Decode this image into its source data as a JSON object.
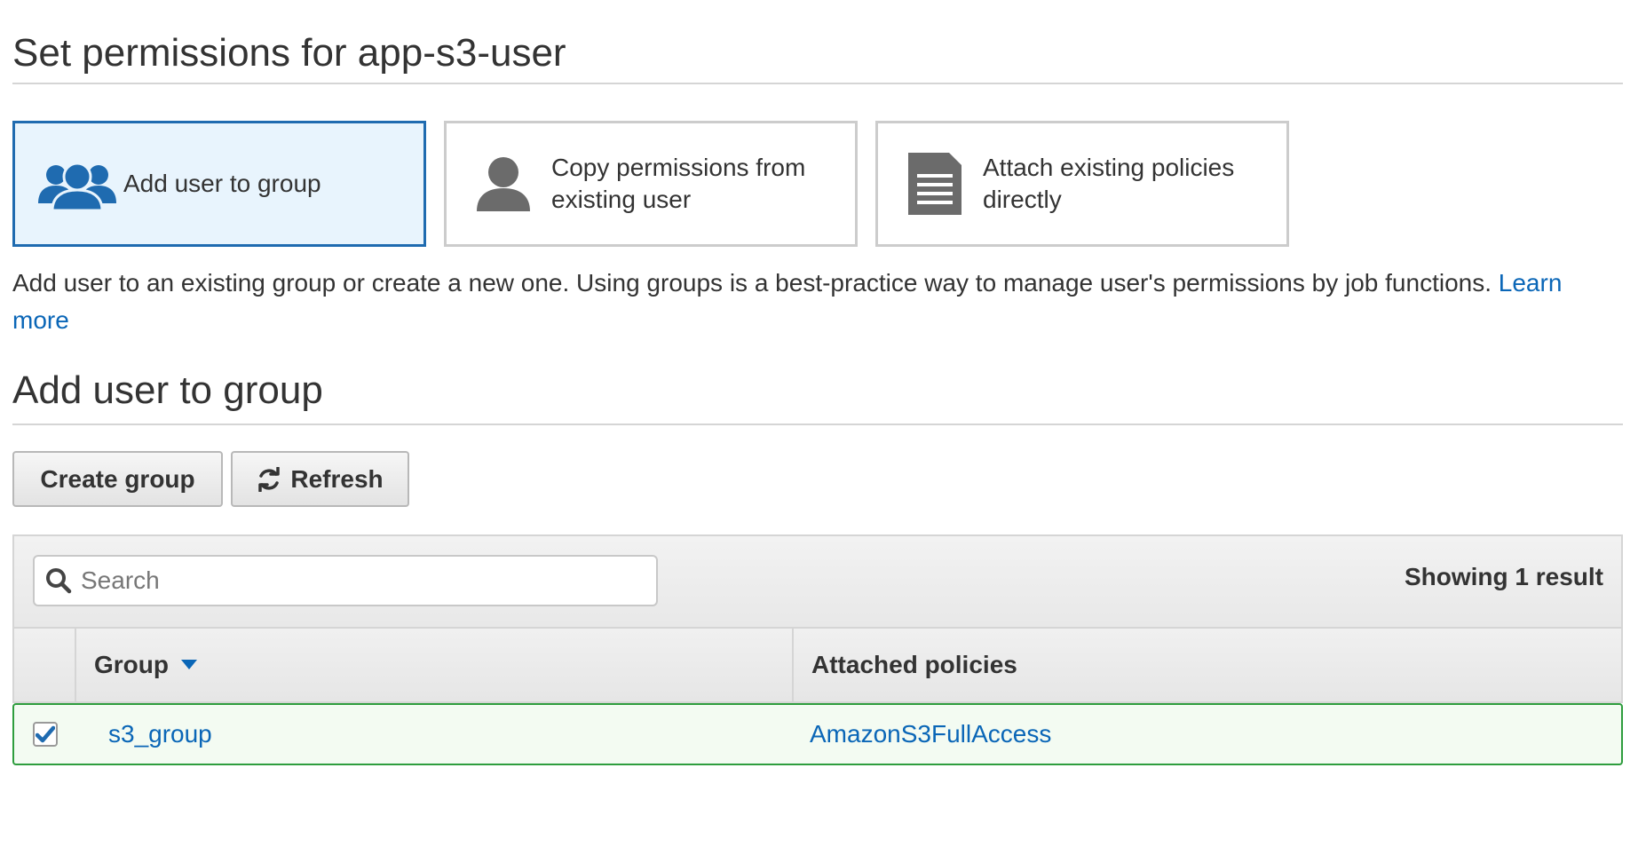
{
  "page": {
    "title": "Set permissions for app-s3-user"
  },
  "options": [
    {
      "label": "Add user to group",
      "icon": "group-icon",
      "selected": true
    },
    {
      "label": "Copy permissions from existing user",
      "icon": "user-icon",
      "selected": false
    },
    {
      "label": "Attach existing policies directly",
      "icon": "document-icon",
      "selected": false
    }
  ],
  "help": {
    "text": "Add user to an existing group or create a new one. Using groups is a best-practice way to manage user's permissions by job functions.",
    "link_label": "Learn more"
  },
  "group_section": {
    "title": "Add user to group",
    "create_button": "Create group",
    "refresh_button": "Refresh"
  },
  "table": {
    "search_placeholder": "Search",
    "result_count": "Showing 1 result",
    "columns": {
      "group": "Group",
      "policies": "Attached policies"
    },
    "rows": [
      {
        "group": "s3_group",
        "policies": "AmazonS3FullAccess",
        "checked": true
      }
    ]
  },
  "colors": {
    "accent": "#1f6bb0",
    "link": "#0a66b7",
    "selected_row_border": "#2e9d3e",
    "selected_row_bg": "#f3fbf2",
    "selected_card_bg": "#e8f4fd"
  }
}
